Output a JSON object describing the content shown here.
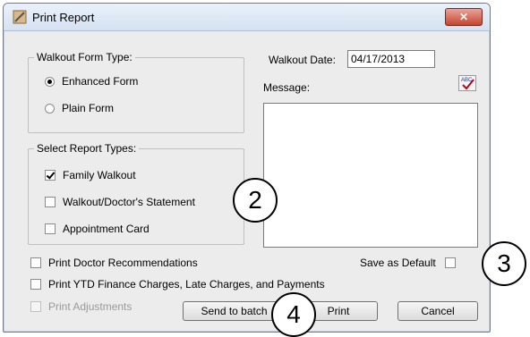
{
  "window": {
    "title": "Print Report",
    "close_label": "✕"
  },
  "walkout_form_type": {
    "legend": "Walkout Form Type:",
    "options": [
      {
        "label": "Enhanced Form",
        "selected": true
      },
      {
        "label": "Plain Form",
        "selected": false
      }
    ]
  },
  "report_types": {
    "legend": "Select Report Types:",
    "items": [
      {
        "label": "Family Walkout",
        "checked": true
      },
      {
        "label": "Walkout/Doctor's Statement",
        "checked": false
      },
      {
        "label": "Appointment Card",
        "checked": false
      }
    ]
  },
  "walkout_date": {
    "label": "Walkout Date:",
    "value": "04/17/2013"
  },
  "message": {
    "label": "Message:",
    "value": ""
  },
  "spellcheck": {
    "icon": "spellcheck-icon",
    "text": "ABC"
  },
  "options": {
    "print_doctor_recommendations": {
      "label": "Print Doctor Recommendations",
      "checked": false
    },
    "save_as_default": {
      "label": "Save as Default",
      "checked": false
    },
    "print_ytd": {
      "label": "Print YTD Finance Charges, Late Charges, and Payments",
      "checked": false
    },
    "print_adjustments": {
      "label": "Print Adjustments",
      "checked": false,
      "enabled": false
    }
  },
  "buttons": {
    "send_to_batch": "Send to batch",
    "print": "Print",
    "cancel": "Cancel"
  },
  "callouts": [
    "2",
    "3",
    "4"
  ]
}
